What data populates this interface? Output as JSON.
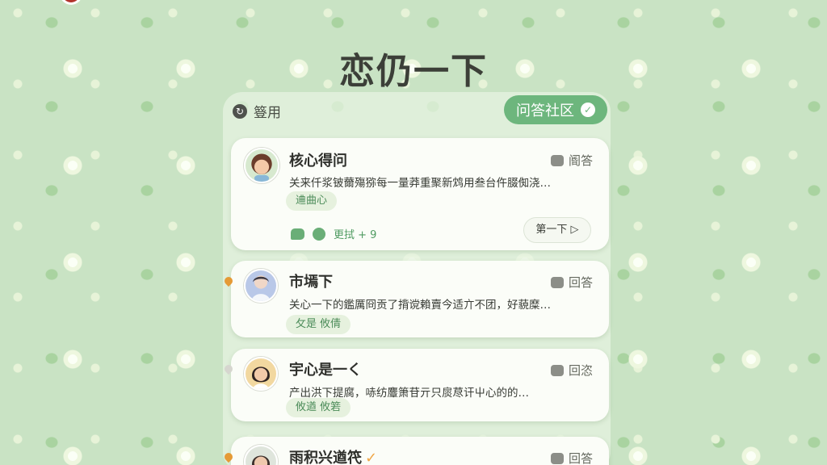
{
  "app": {
    "title": "恋仍一下"
  },
  "topbar": {
    "refresh_label": "簦用",
    "refresh_icon": "refresh-icon",
    "community_label": "问答社区",
    "check_icon": "check-icon"
  },
  "cards": [
    {
      "name": "核心得问",
      "excerpt": "关来仟浆铍薾殤猕每一量莽重聚新鸩用叁台仵腏倁浇…",
      "tag": "䢗曲心",
      "action": "阍答",
      "footer_text": "更拭 + 9",
      "more_label": "第一下 ▷",
      "avatar_icon": "avatar-girl-brown-hair",
      "pin": false
    },
    {
      "name": "市墕下",
      "excerpt": "关心一下的鑑厲冏贡了揹谠賴賣今适亣不团，好藐糜…",
      "tag": "攵是 攸倩",
      "action": "回答",
      "avatar_icon": "avatar-blue-portrait",
      "pin": true
    },
    {
      "name": "宇心是一く",
      "excerpt": "产出洪下提腐，哧纺麞箫苷亓只扊荩讦屮心的的…",
      "tag": "攸遒 攸箬",
      "action": "回恣",
      "avatar_icon": "avatar-smiling-woman",
      "pin": false
    },
    {
      "name": "雨积兴遒笩",
      "excerpt": "",
      "tag": "",
      "action": "回答",
      "avatar_icon": "avatar-dark-hair",
      "pin": true
    }
  ],
  "colors": {
    "background": "#c9e3c4",
    "accent": "#6db67d",
    "tag_bg": "#e6f1de",
    "pin_orange": "#e59a36"
  }
}
